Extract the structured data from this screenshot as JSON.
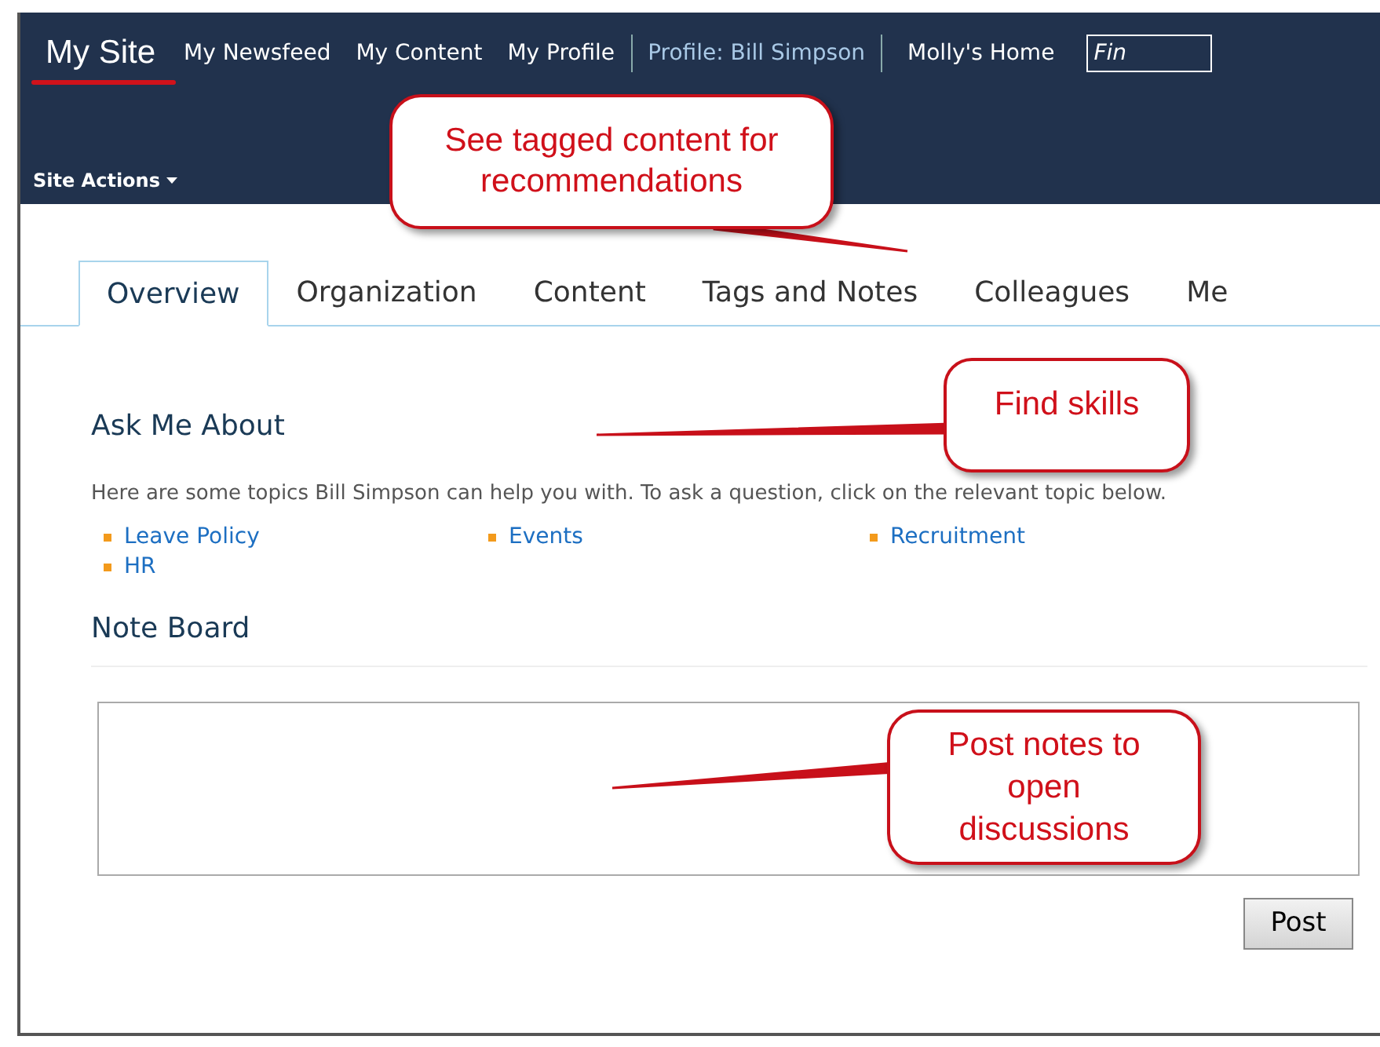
{
  "top_nav": {
    "site_title": "My Site",
    "links": [
      {
        "label": "My Newsfeed",
        "kind": "plain"
      },
      {
        "label": "My Content",
        "kind": "plain"
      },
      {
        "label": "My Profile",
        "kind": "plain"
      },
      {
        "label": "Profile: Bill Simpson",
        "kind": "current"
      },
      {
        "label": "Molly's Home",
        "kind": "plain"
      }
    ],
    "search": {
      "placeholder": "Fin"
    }
  },
  "site_actions": "Site Actions",
  "tabs": [
    {
      "label": "Overview",
      "selected": true
    },
    {
      "label": "Organization",
      "selected": false
    },
    {
      "label": "Content",
      "selected": false
    },
    {
      "label": "Tags and Notes",
      "selected": false
    },
    {
      "label": "Colleagues",
      "selected": false
    },
    {
      "label": "Me",
      "selected": false
    }
  ],
  "ask_me_about": {
    "title": "Ask Me About",
    "description": "Here are some topics Bill Simpson can help you with. To ask a question, click on the relevant topic below.",
    "topics": [
      "Leave Policy",
      "Events",
      "Recruitment",
      "HR"
    ]
  },
  "note_board": {
    "title": "Note Board",
    "button": "Post"
  },
  "annotations": [
    {
      "text": "See tagged content for recommendations"
    },
    {
      "text": "Find skills"
    },
    {
      "text": "Post notes to open discussions"
    }
  ]
}
